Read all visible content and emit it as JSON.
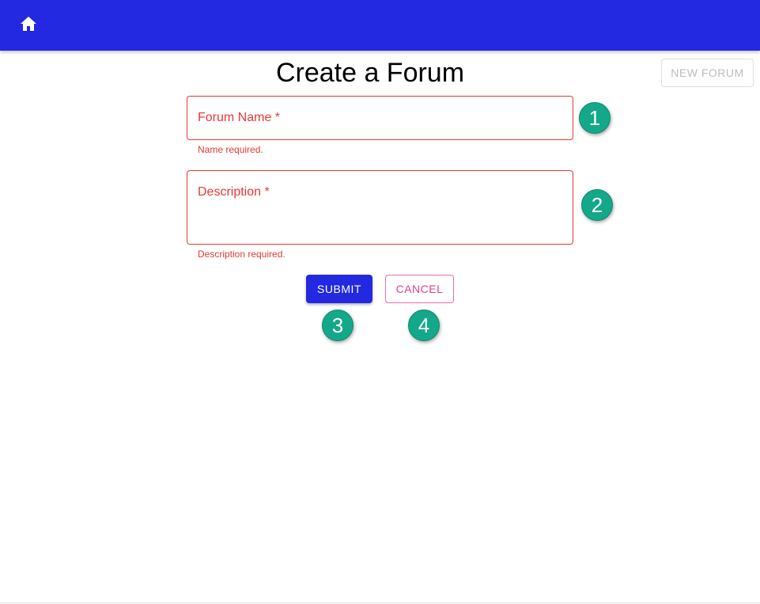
{
  "header": {
    "home_icon": "home-icon",
    "background_color": "#2229e0"
  },
  "toolbar": {
    "new_forum_label": "NEW FORUM"
  },
  "page": {
    "title": "Create a Forum"
  },
  "form": {
    "name_field": {
      "label": "Forum Name *",
      "value": "",
      "helper": "Name required."
    },
    "description_field": {
      "label": "Description *",
      "value": "",
      "helper": "Description required."
    },
    "submit_label": "SUBMIT",
    "cancel_label": "CANCEL"
  },
  "markers": [
    "1",
    "2",
    "3",
    "4"
  ],
  "colors": {
    "error": "#e53935",
    "primary": "#2229e0",
    "secondary": "#e0408f",
    "marker": "#13a889"
  }
}
